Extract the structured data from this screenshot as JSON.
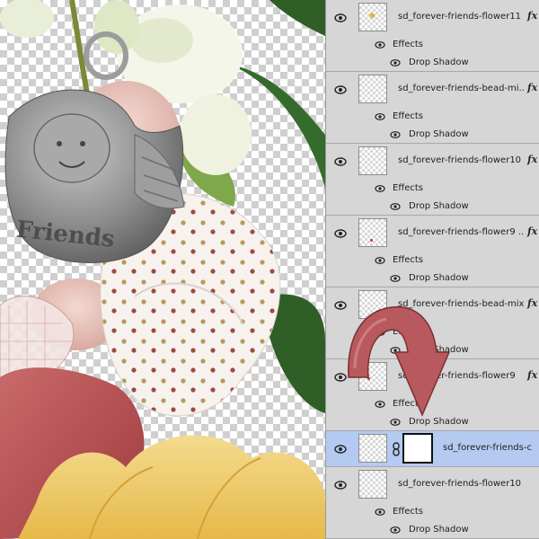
{
  "layers": [
    {
      "name": "sd_forever-friends-flower11",
      "fx": "fx",
      "effects_label": "Effects",
      "shadow_label": "Drop Shadow"
    },
    {
      "name": "sd_forever-friends-bead-mi...",
      "fx": "fx",
      "effects_label": "Effects",
      "shadow_label": "Drop Shadow"
    },
    {
      "name": "sd_forever-friends-flower10",
      "fx": "fx",
      "effects_label": "Effects",
      "shadow_label": "Drop Shadow"
    },
    {
      "name": "sd_forever-friends-flower9 ...",
      "fx": "fx",
      "effects_label": "Effects",
      "shadow_label": "Drop Shadow"
    },
    {
      "name": "sd_forever-friends-bead-mix",
      "fx": "fx",
      "effects_label": "Effects",
      "shadow_label": "Drop Shadow"
    },
    {
      "name": "sd_forever-friends-flower9",
      "fx": "fx",
      "effects_label": "Effects",
      "shadow_label": "Drop Shadow"
    }
  ],
  "adjustment_layer": {
    "name": "sd_forever-friends-c..."
  },
  "bottom_layer": {
    "name": "sd_forever-friends-flower10",
    "effects_label": "Effects",
    "shadow_label": "Drop Shadow"
  },
  "charm_text": "Friends",
  "colors": {
    "selection": "#b4caf0",
    "arrow": "#b85a5d",
    "panel": "#d6d6d6"
  }
}
